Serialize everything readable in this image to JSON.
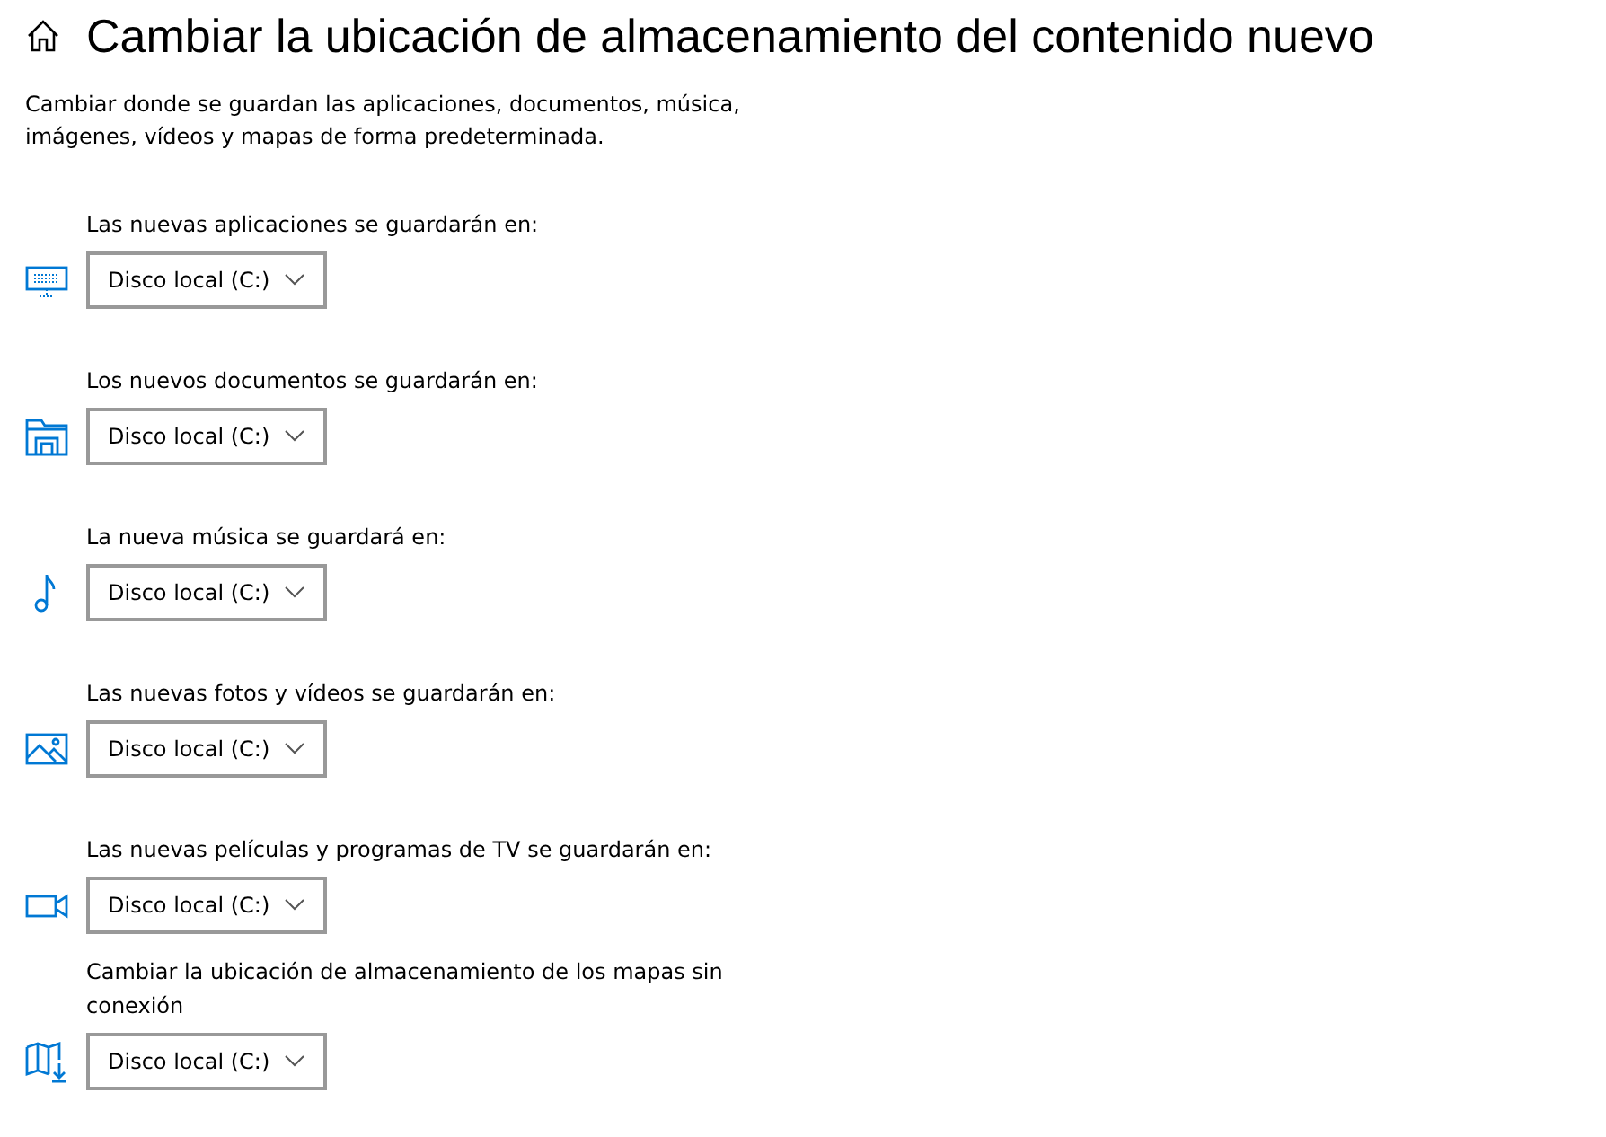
{
  "header": {
    "title": "Cambiar la ubicación de almacenamiento del contenido nuevo"
  },
  "description": "Cambiar donde se guardan las aplicaciones, documentos, música, imágenes, vídeos y mapas de forma predeterminada.",
  "locations": [
    {
      "kind": "apps",
      "label": "Las nuevas aplicaciones se guardarán en:",
      "value": "Disco local (C:)"
    },
    {
      "kind": "documents",
      "label": "Los nuevos documentos se guardarán en:",
      "value": "Disco local (C:)"
    },
    {
      "kind": "music",
      "label": "La nueva música se guardará en:",
      "value": "Disco local (C:)"
    },
    {
      "kind": "photos",
      "label": "Las nuevas fotos y vídeos se guardarán en:",
      "value": "Disco local (C:)"
    },
    {
      "kind": "videos",
      "label": "Las nuevas películas y programas de TV se guardarán en:",
      "value": "Disco local (C:)"
    },
    {
      "kind": "maps",
      "label": "Cambiar la ubicación de almacenamiento de los mapas sin conexión",
      "value": "Disco local (C:)"
    }
  ]
}
